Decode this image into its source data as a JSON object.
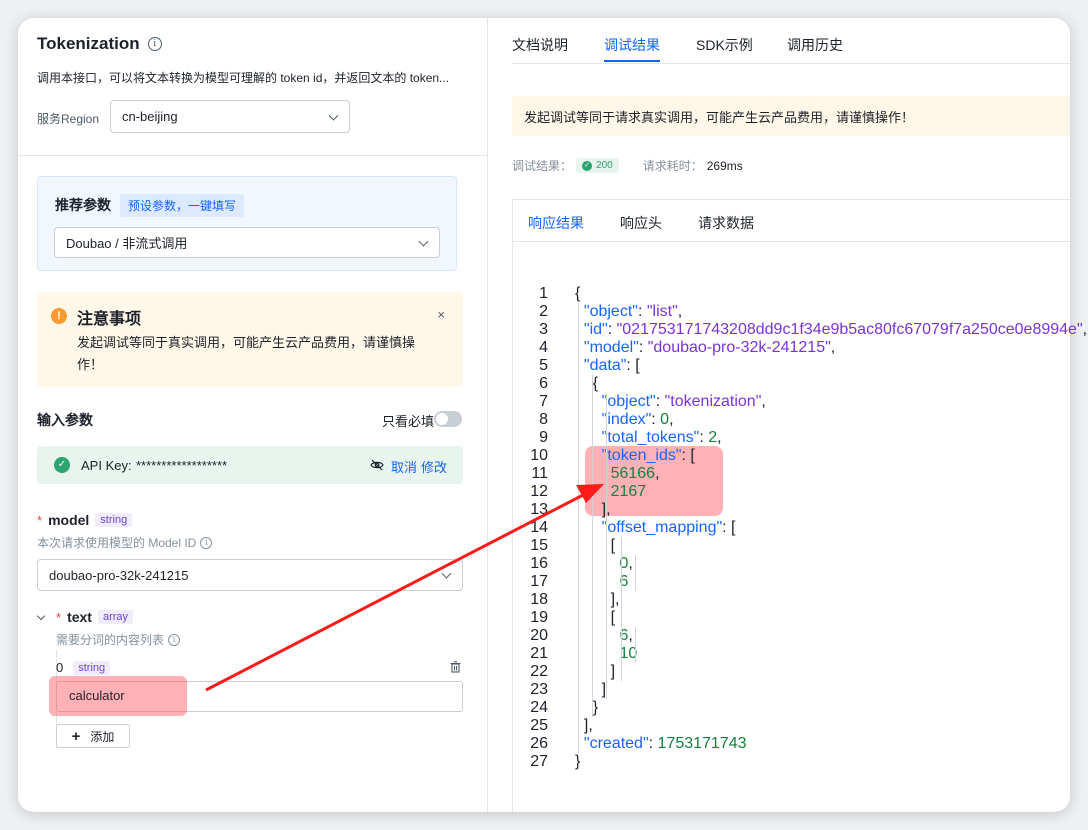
{
  "left": {
    "title": "Tokenization",
    "description": "调用本接口，可以将文本转换为模型可理解的 token id，并返回文本的 token...",
    "region_label": "服务Region",
    "region_value": "cn-beijing",
    "recommend": {
      "title": "推荐参数",
      "tag": "预设参数，一键填写",
      "select_value": "Doubao / 非流式调用"
    },
    "warning": {
      "title": "注意事项",
      "text": "发起调试等同于真实调用，可能产生云产品费用，请谨慎操作！",
      "close": "×"
    },
    "input_params": {
      "title": "输入参数",
      "required_only": "只看必填"
    },
    "api_key": {
      "label": "API Key:",
      "value": "******************",
      "cancel": "取消",
      "edit": "修改"
    },
    "model_field": {
      "star": "*",
      "name": "model",
      "type": "string",
      "desc": "本次请求使用模型的 Model ID",
      "value": "doubao-pro-32k-241215"
    },
    "text_field": {
      "star": "*",
      "name": "text",
      "type": "array",
      "desc": "需要分词的内容列表",
      "item_index": "0",
      "item_type": "string",
      "item_value": "calculator",
      "add_label": "添加"
    }
  },
  "right": {
    "tabs": [
      "文档说明",
      "调试结果",
      "SDK示例",
      "调用历史"
    ],
    "active_tab": "调试结果",
    "notice": "发起调试等同于请求真实调用，可能产生云产品费用，请谨慎操作！",
    "status_label": "调试结果：",
    "status_code": "200",
    "time_label": "请求耗时：",
    "time_value": "269ms",
    "panel_tabs": [
      "响应结果",
      "响应头",
      "请求数据"
    ],
    "code_lines": [
      "{",
      "  \"object\": \"list\",",
      "  \"id\": \"021753171743208dd9c1f34e9b5ac80fc67079f7a250ce0e8994e\",",
      "  \"model\": \"doubao-pro-32k-241215\",",
      "  \"data\": [",
      "    {",
      "      \"object\": \"tokenization\",",
      "      \"index\": 0,",
      "      \"total_tokens\": 2,",
      "      \"token_ids\": [",
      "        56166,",
      "        2167",
      "      ],",
      "      \"offset_mapping\": [",
      "        [",
      "          0,",
      "          6",
      "        ],",
      "        [",
      "          6,",
      "          10",
      "        ]",
      "      ]",
      "    }",
      "  ],",
      "  \"created\": 1753171743",
      "}"
    ]
  },
  "colors": {
    "accent": "#1664ff",
    "highlight": "#ff646e",
    "arrow": "#ff1a1a",
    "success": "#2ba471"
  }
}
